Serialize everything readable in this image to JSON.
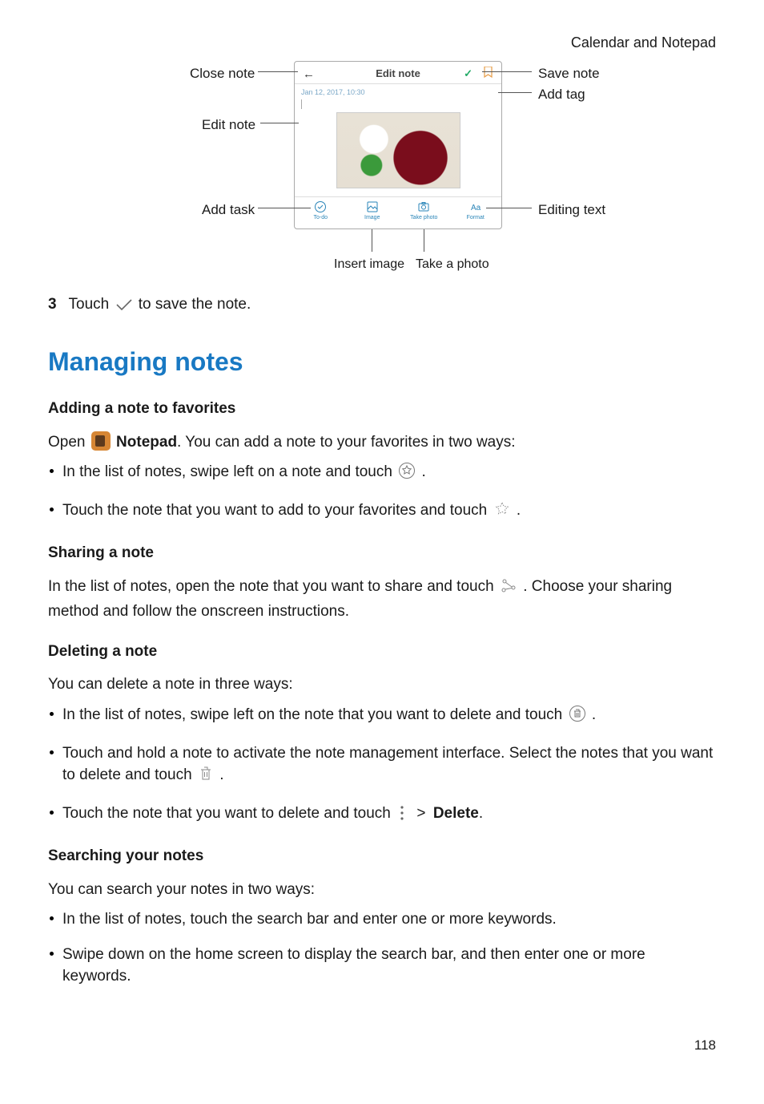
{
  "header": {
    "breadcrumb": "Calendar and Notepad"
  },
  "diagram": {
    "labels": {
      "close_note": "Close note",
      "edit_note_left": "Edit note",
      "add_task": "Add task",
      "save_note": "Save note",
      "add_tag": "Add tag",
      "editing_text": "Editing text",
      "insert_image": "Insert image",
      "take_photo": "Take a photo"
    },
    "phone": {
      "title": "Edit note",
      "timestamp": "Jan 12, 2017, 10:30",
      "toolbar": {
        "todo": "To-do",
        "image": "Image",
        "take_photo": "Take photo",
        "format": "Format"
      }
    }
  },
  "step3": {
    "number": "3",
    "text_before": "Touch ",
    "text_after": " to save the note."
  },
  "managing_notes": {
    "heading": "Managing notes",
    "favorites": {
      "heading": "Adding a note to favorites",
      "open_before": "Open ",
      "app_name": "Notepad",
      "open_after": ". You can add a note to your favorites in two ways:",
      "bullet1_before": "In the list of notes, swipe left on a note and touch ",
      "bullet1_after": ".",
      "bullet2_before": "Touch the note that you want to add to your favorites and touch ",
      "bullet2_after": "."
    },
    "sharing": {
      "heading": "Sharing a note",
      "text_before": "In the list of notes, open the note that you want to share and touch ",
      "text_after": ". Choose your sharing method and follow the onscreen instructions."
    },
    "deleting": {
      "heading": "Deleting a note",
      "intro": "You can delete a note in three ways:",
      "bullet1_before": "In the list of notes, swipe left on the note that you want to delete and touch ",
      "bullet1_after": ".",
      "bullet2_before": "Touch and hold a note to activate the note management interface. Select the notes that you want to delete and touch ",
      "bullet2_after": ".",
      "bullet3_before": "Touch the note that you want to delete and touch ",
      "bullet3_gt": ">",
      "bullet3_bold": "Delete",
      "bullet3_after": "."
    },
    "searching": {
      "heading": "Searching your notes",
      "intro": "You can search your notes in two ways:",
      "bullet1": "In the list of notes, touch the search bar and enter one or more keywords.",
      "bullet2": "Swipe down on the home screen to display the search bar, and then enter one or more keywords."
    }
  },
  "page_number": "118"
}
